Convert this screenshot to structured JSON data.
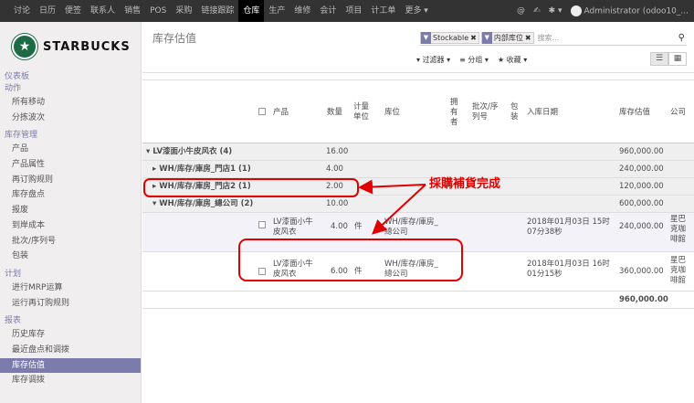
{
  "topbar": {
    "menu": [
      "讨论",
      "日历",
      "便签",
      "联系人",
      "销售",
      "POS",
      "采购",
      "链接跟踪",
      "仓库",
      "生产",
      "维修",
      "会计",
      "项目",
      "计工单",
      "更多 ▾"
    ],
    "active_index": 8,
    "user": "Administrator (odoo10_..."
  },
  "brand": {
    "name": "STARBUCKS"
  },
  "sidebar": {
    "sections": [
      {
        "label": "仪表板",
        "items": []
      },
      {
        "label": "动作",
        "items": [
          "所有移动",
          "分拣波次"
        ]
      },
      {
        "label": "库存管理",
        "items": [
          "产品",
          "产品属性",
          "再订购规则",
          "库存盘点",
          "报废",
          "到岸成本",
          "批次/序列号",
          "包装"
        ]
      },
      {
        "label": "计划",
        "items": [
          "进行MRP运算",
          "运行再订购规则"
        ]
      },
      {
        "label": "报表",
        "items": [
          "历史库存",
          "最近盘点和调拨",
          "库存估值",
          "库存调拨"
        ]
      }
    ],
    "active_item": "库存估值"
  },
  "control_panel": {
    "title": "库存估值",
    "facets": [
      "Stockable",
      "内部库位"
    ],
    "search_placeholder": "搜索...",
    "filters_label": "▾ 过滤器 ▾",
    "groupby_label": "≡ 分组 ▾",
    "favorites_label": "★ 收藏 ▾"
  },
  "table": {
    "headers": {
      "product": "产品",
      "qty": "数量",
      "uom": "计量\n单位",
      "location": "库位",
      "owner": "拥\n有\n者",
      "lot": "批次/序\n列号",
      "package": "包\n装",
      "in_date": "入库日期",
      "value": "库存估值",
      "company": "公司"
    },
    "groups": [
      {
        "label": "▾ LV漆面小牛皮风衣 (4)",
        "qty": "16.00",
        "value": "960,000.00"
      },
      {
        "label": "▸ WH/库存/庫房_門店1 (1)",
        "qty": "4.00",
        "value": "240,000.00"
      },
      {
        "label": "▸ WH/库存/庫房_門店2 (1)",
        "qty": "2.00",
        "value": "120,000.00"
      },
      {
        "label": "▾ WH/库存/庫房_總公司 (2)",
        "qty": "10.00",
        "value": "600,000.00"
      }
    ],
    "rows": [
      {
        "product": "LV漆面小牛\n皮风衣",
        "qty": "4.00",
        "uom": "件",
        "location": "WH/库存/庫房_\n總公司",
        "in_date": "2018年01月03日 15时\n07分38秒",
        "value": "240,000.00",
        "company": "星巴\n克咖\n啡館"
      },
      {
        "product": "LV漆面小牛\n皮风衣",
        "qty": "6.00",
        "uom": "件",
        "location": "WH/库存/庫房_\n總公司",
        "in_date": "2018年01月03日 16时\n01分15秒",
        "value": "360,000.00",
        "company": "星巴\n克咖\n啡館"
      }
    ],
    "total_value": "960,000.00"
  },
  "annotation": {
    "text": "採購補貨完成",
    "color": "#e00000"
  }
}
